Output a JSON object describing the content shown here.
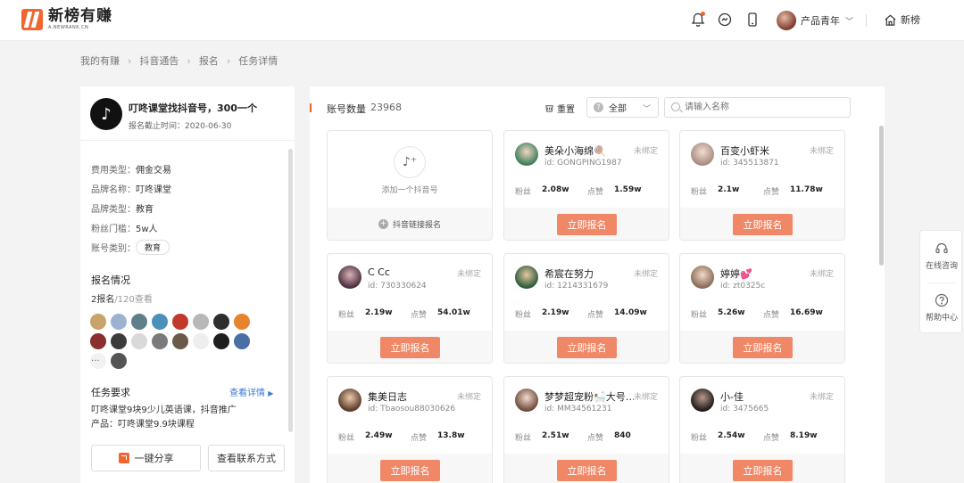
{
  "header": {
    "logo_name": "新榜有赚",
    "logo_sub": "A.NEWRANK.CN",
    "user_name": "产品青年",
    "home_label": "新榜",
    "icons": [
      "bell-icon",
      "chat-icon",
      "phone-icon",
      "home-icon"
    ],
    "accent": "#f0662e"
  },
  "breadcrumb": [
    "我的有赚",
    "抖音通告",
    "报名",
    "任务详情"
  ],
  "task": {
    "title": "叮咚课堂找抖音号，300一个",
    "deadline": "报名截止时间：2020-06-30",
    "fields": [
      {
        "label": "费用类型：",
        "value": "佣金交易"
      },
      {
        "label": "品牌名称：",
        "value": "叮咚课堂"
      },
      {
        "label": "品牌类型：",
        "value": "教育"
      },
      {
        "label": "粉丝门槛：",
        "value": "5w人"
      },
      {
        "label": "账号类别：",
        "value": "教育"
      }
    ],
    "signup_title": "报名情况",
    "signup_count": "2报名",
    "signup_views": "/120查看",
    "ellipsis": "...",
    "req_title": "任务要求",
    "req_link": "查看详情",
    "req_line1": "叮咚课堂9块9少儿英语课，抖音推广",
    "req_line2": "产品：叮咚课堂9.9块课程",
    "share_btn": "一键分享",
    "contact_btn": "查看联系方式"
  },
  "accounts": {
    "count_label": "账号数量",
    "count_value": "23968",
    "reset_label": "重置",
    "filter_value": "全部",
    "search_placeholder": "请输入名称",
    "add_label": "添加一个抖音号",
    "link_label": "抖音链接报名",
    "fans_label": "粉丝",
    "likes_label": "点赞",
    "status": "未绑定",
    "apply_label": "立即报名",
    "cards": [
      {
        "name": "美朵小海绵🍭",
        "id": "id: GONGPING1987",
        "fans": "2.08w",
        "likes": "1.59w"
      },
      {
        "name": "百变小虾米",
        "id": "id: 345513871",
        "fans": "2.1w",
        "likes": "11.78w"
      },
      {
        "name": "C Cc",
        "id": "id: 730330624",
        "fans": "2.19w",
        "likes": "54.01w"
      },
      {
        "name": "希宸在努力",
        "id": "id: 1214331679",
        "fans": "2.19w",
        "likes": "14.09w"
      },
      {
        "name": "婷婷💕",
        "id": "id: zt0325c",
        "fans": "5.26w",
        "likes": "16.69w"
      },
      {
        "name": "集美日志",
        "id": "id: Tbaosou88030626",
        "fans": "2.49w",
        "likes": "13.8w"
      },
      {
        "name": "梦梦超宠粉🛀大号…",
        "id": "id: MM34561231",
        "fans": "2.51w",
        "likes": "840"
      },
      {
        "name": "小-佳",
        "id": "id: 3475665",
        "fans": "2.54w",
        "likes": "8.19w"
      }
    ]
  },
  "float_bar": {
    "consult": "在线咨询",
    "help": "帮助中心"
  }
}
